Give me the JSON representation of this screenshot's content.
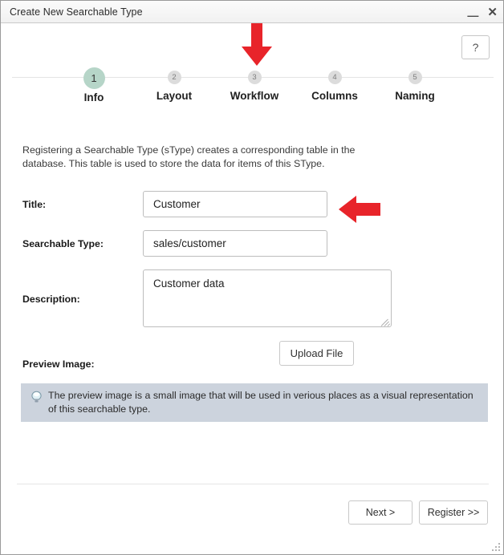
{
  "window": {
    "title": "Create New Searchable Type",
    "minimize_icon": "minimize-icon",
    "minimize_glyph": "—",
    "close_icon": "close-icon",
    "close_glyph": "✕",
    "resize_grip_icon": "resize-grip-icon"
  },
  "help": {
    "label": "?",
    "icon": "question-mark-icon"
  },
  "stepper": {
    "steps": [
      {
        "number": "1",
        "label": "Info",
        "active": true
      },
      {
        "number": "2",
        "label": "Layout",
        "active": false
      },
      {
        "number": "3",
        "label": "Workflow",
        "active": false
      },
      {
        "number": "4",
        "label": "Columns",
        "active": false
      },
      {
        "number": "5",
        "label": "Naming",
        "active": false
      }
    ],
    "active_circle_color": "#b6d5c8",
    "inactive_circle_color": "#dcdcdc",
    "connector_color": "#e4e4e4"
  },
  "intro": {
    "text": "Registering a Searchable Type (sType) creates a corresponding table in the database. This table is used to store the data for items of this SType."
  },
  "form": {
    "title": {
      "label": "Title:",
      "value": "Customer",
      "placeholder": ""
    },
    "searchable_type": {
      "label": "Searchable Type:",
      "value": "sales/customer",
      "placeholder": ""
    },
    "description": {
      "label": "Description:",
      "value": "Customer data",
      "placeholder": ""
    },
    "preview_image": {
      "label": "Preview Image:",
      "upload_button_label": "Upload File"
    }
  },
  "tip": {
    "icon": "lightbulb-icon",
    "text": "The preview image is a small image that will be used in verious places as a visual representation of this searchable type.",
    "background_color": "#ccd3dd"
  },
  "footer": {
    "next_label": "Next >",
    "register_label": "Register >>"
  },
  "annotations": {
    "color": "#e8242a",
    "arrow_down": {
      "icon": "red-arrow-down-icon",
      "points_at": "Workflow"
    },
    "arrow_left": {
      "icon": "red-arrow-left-icon",
      "points_at": "Title"
    }
  }
}
